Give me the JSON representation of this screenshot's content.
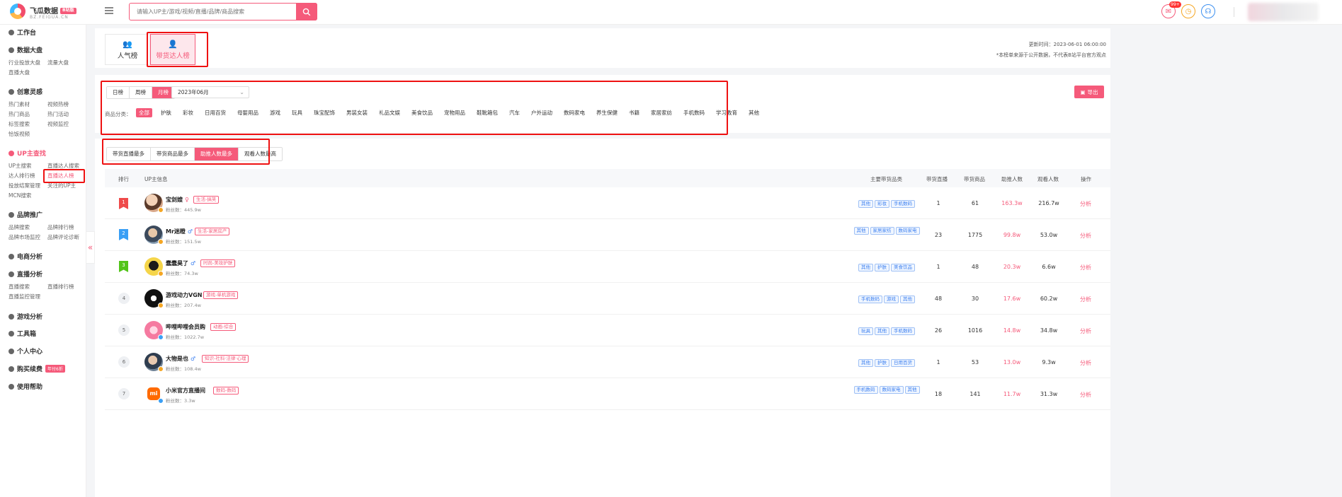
{
  "brand": {
    "name": "飞瓜数据",
    "sub": "BZ.FEIGUA.CN",
    "badge": "B站版"
  },
  "search": {
    "placeholder": "请输入UP主/游戏/视频/直播/品牌/商品搜索"
  },
  "header": {
    "msg_badge": "99+"
  },
  "sidebar": {
    "sections": [
      {
        "label": "工作台"
      },
      {
        "label": "数据大盘",
        "items": [
          "行业投放大盘",
          "流量大盘",
          "直播大盘"
        ]
      },
      {
        "label": "创意灵感",
        "items": [
          "热门素材",
          "视频热榜",
          "热门商品",
          "热门活动",
          "标签搜索",
          "视频监控",
          "恰饭视频"
        ]
      },
      {
        "label": "UP主查找",
        "items": [
          "UP主搜索",
          "直播达人搜索",
          "达人排行榜",
          "直播达人榜",
          "投放结案管理",
          "关注的UP主",
          "MCN搜索"
        ]
      },
      {
        "label": "品牌推广",
        "items": [
          "品牌搜索",
          "品牌排行榜",
          "品牌市场监控",
          "品牌评论诊断"
        ]
      },
      {
        "label": "电商分析"
      },
      {
        "label": "直播分析",
        "items": [
          "直播搜索",
          "直播排行榜",
          "直播监控管理"
        ]
      },
      {
        "label": "游戏分析"
      },
      {
        "label": "工具箱"
      },
      {
        "label": "个人中心"
      },
      {
        "label": "购买续费",
        "badge": "年付6折"
      },
      {
        "label": "使用帮助"
      }
    ],
    "collapse": "«"
  },
  "tabs": {
    "popular": "人气榜",
    "live": "带货达人榜"
  },
  "meta": {
    "update_time": "更新时间：2023-06-01 06:00:00",
    "notice": "*本榜单来源于公开数据，不代表B站平台官方观点"
  },
  "period": {
    "options": [
      "日榜",
      "周榜",
      "月榜"
    ],
    "selected": "月榜",
    "month": "2023年06月"
  },
  "category": {
    "label": "商品分类：",
    "options": [
      "全部",
      "护肤",
      "彩妆",
      "日用百货",
      "母婴用品",
      "游戏",
      "玩具",
      "珠宝配饰",
      "男装女装",
      "礼品文娱",
      "美食饮品",
      "宠物用品",
      "鞋靴箱包",
      "汽车",
      "户外运动",
      "数码家电",
      "养生保健",
      "书籍",
      "家居家纺",
      "手机数码",
      "学习教育",
      "其他"
    ],
    "selected": "全部"
  },
  "export": "导出",
  "sort": {
    "options": [
      "带货直播最多",
      "带货商品最多",
      "助推人数最多",
      "观看人数最高"
    ],
    "selected": "助推人数最多"
  },
  "table": {
    "headers": {
      "rank": "排行",
      "up": "UP主信息",
      "cats": "主要带货品类",
      "lives": "带货直播",
      "goods": "带货商品",
      "boost": "助推人数",
      "views": "观看人数",
      "op": "操作"
    },
    "rows": [
      {
        "rank": "1",
        "name": "宝剑嫂",
        "gender": "♀",
        "tag": "生活-搞笑",
        "fans": "粉丝数：445.9w",
        "cats": [
          "其他",
          "彩妆",
          "手机数码"
        ],
        "lives": "1",
        "goods": "61",
        "boost": "163.3w",
        "views": "216.7w",
        "op": "分析"
      },
      {
        "rank": "2",
        "name": "Mr迷瞪",
        "gender": "♂",
        "tag": "生活-家居房产",
        "fans": "粉丝数：151.5w",
        "cats": [
          "其他",
          "家居家纺",
          "数码家电"
        ],
        "lives": "23",
        "goods": "1775",
        "boost": "99.8w",
        "views": "53.0w",
        "op": "分析"
      },
      {
        "rank": "3",
        "name": "蠢蠢昊了",
        "gender": "♂",
        "tag": "时尚-美妆护肤",
        "fans": "粉丝数：74.3w",
        "cats": [
          "其他",
          "护肤",
          "美食饮品"
        ],
        "lives": "1",
        "goods": "48",
        "boost": "20.3w",
        "views": "6.6w",
        "op": "分析"
      },
      {
        "rank": "4",
        "name": "游戏动力VGN",
        "gender": "",
        "tag": "游戏-单机游戏",
        "fans": "粉丝数：207.4w",
        "cats": [
          "手机数码",
          "游戏",
          "其他"
        ],
        "lives": "48",
        "goods": "30",
        "boost": "17.6w",
        "views": "60.2w",
        "op": "分析"
      },
      {
        "rank": "5",
        "name": "哔哩哔哩会员购",
        "gender": "",
        "tag": "动画-综合",
        "fans": "粉丝数：1022.7w",
        "cats": [
          "玩具",
          "其他",
          "手机数码"
        ],
        "lives": "26",
        "goods": "1016",
        "boost": "14.8w",
        "views": "34.8w",
        "op": "分析"
      },
      {
        "rank": "6",
        "name": "大物是也",
        "gender": "♂",
        "tag": "知识-社科·法律·心理",
        "fans": "粉丝数：108.4w",
        "cats": [
          "其他",
          "护肤",
          "日用百货"
        ],
        "lives": "1",
        "goods": "53",
        "boost": "13.0w",
        "views": "9.3w",
        "op": "分析"
      },
      {
        "rank": "7",
        "name": "小米官方直播间",
        "gender": "",
        "tag": "数码-数码",
        "fans": "粉丝数：3.3w",
        "cats": [
          "手机数码",
          "数码家电",
          "其他"
        ],
        "lives": "18",
        "goods": "141",
        "boost": "11.7w",
        "views": "31.3w",
        "op": "分析"
      }
    ]
  },
  "colors": {
    "accent": "#f55a7a",
    "highlight": "#e11111",
    "tag_blue": "#3b7ff0"
  }
}
